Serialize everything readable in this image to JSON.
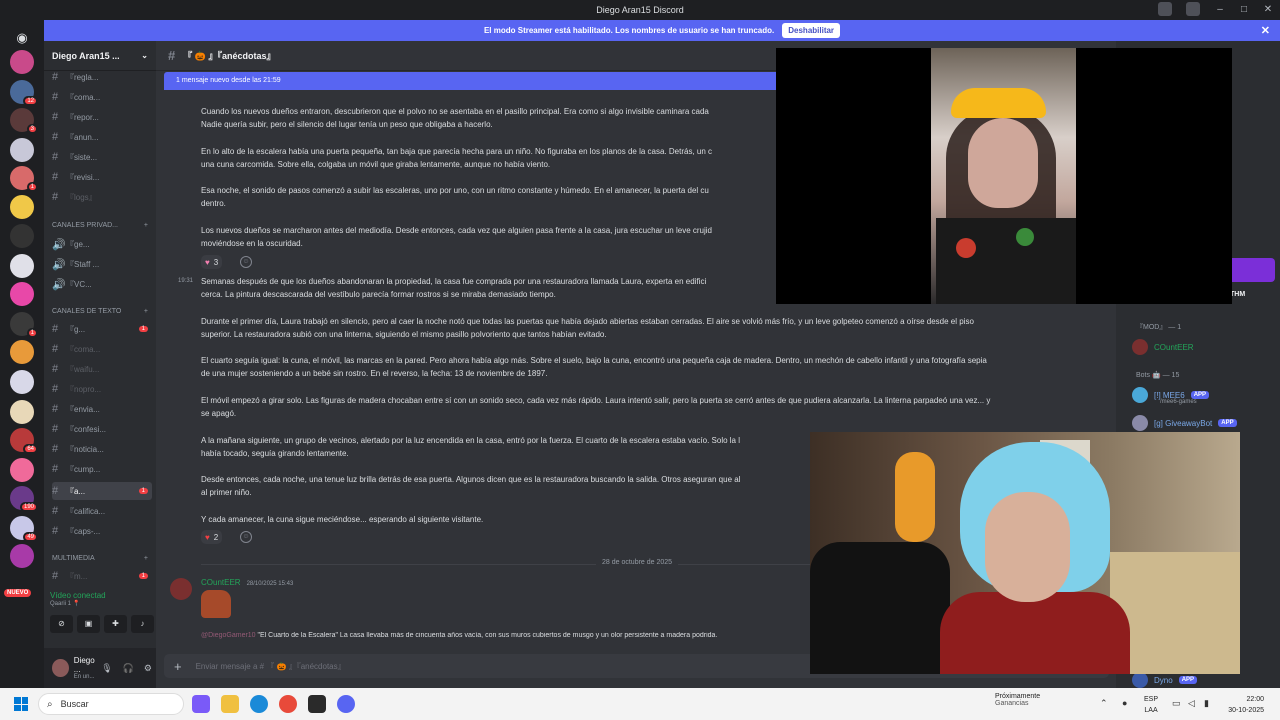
{
  "window": {
    "title": "Diego Aran15 Discord"
  },
  "banner": {
    "text": "El modo Streamer está habilitado. Los nombres de usuario se han truncado.",
    "button": "Deshabilitar"
  },
  "servers": {
    "nuevo": "NUEVO",
    "badges": [
      "12",
      "3",
      "1",
      "1",
      "64",
      "190",
      "49"
    ]
  },
  "guild": {
    "name": "Diego Aran15 ...",
    "channels_top": [
      {
        "label": "『regla..."
      },
      {
        "label": "『coma..."
      },
      {
        "label": "『repor..."
      },
      {
        "label": "『anun..."
      },
      {
        "label": "『siste..."
      },
      {
        "label": "『revisi..."
      },
      {
        "label": "『logs』"
      }
    ],
    "cat_private": "CANALES PRIVAD...",
    "voice_private": [
      {
        "label": "『ge..."
      },
      {
        "label": "『Staff ..."
      },
      {
        "label": "『VC..."
      }
    ],
    "cat_text": "CANALES DE TEXTO",
    "text_channels": [
      {
        "label": "『g...",
        "badge": "1"
      },
      {
        "label": "『coma..."
      },
      {
        "label": "『waifu..."
      },
      {
        "label": "『nopro..."
      },
      {
        "label": "『envia..."
      },
      {
        "label": "『confesi..."
      },
      {
        "label": "『noticia..."
      },
      {
        "label": "『cump..."
      },
      {
        "label": "『a...",
        "badge": "1"
      },
      {
        "label": "『califica..."
      },
      {
        "label": "『caps-..."
      }
    ],
    "cat_media": "MULTIMEDIA",
    "media_channels": [
      {
        "label": "『m...",
        "badge": "1"
      }
    ]
  },
  "voice": {
    "status": "Vídeo conectad",
    "sub": "Qaarii 1 📍"
  },
  "user": {
    "name": "Diego ...",
    "status": "En un..."
  },
  "chat": {
    "channel": "『 🎃 』『anécdotas』",
    "new_messages": "1 mensaje nuevo desde las 21:59",
    "paragraphs": [
      "Cuando los nuevos dueños entraron, descubrieron que el polvo no se asentaba en el pasillo principal. Era como si algo invisible caminara cada",
      "Nadie quería subir, pero el silencio del lugar tenía un peso que obligaba a hacerlo.",
      "En lo alto de la escalera había una puerta pequeña, tan baja que parecía hecha para un niño. No figuraba en los planos de la casa. Detrás, un c",
      "una cuna carcomida. Sobre ella, colgaba un móvil que giraba lentamente, aunque no había viento.",
      "Esa noche, el sonido de pasos comenzó a subir las escaleras, uno por uno, con un ritmo constante y húmedo. En el amanecer, la puerta del cu",
      "dentro.",
      "Los nuevos dueños se marcharon antes del mediodía. Desde entonces, cada vez que alguien pasa frente a la casa, jura escuchar un leve crujid",
      "moviéndose en la oscuridad.",
      "Semanas después de que los dueños abandonaran la propiedad, la casa fue comprada por una restauradora llamada Laura, experta en edifici",
      "cerca. La pintura descascarada del vestíbulo parecía formar rostros si se miraba demasiado tiempo.",
      "Durante el primer día, Laura trabajó en silencio, pero al caer la noche notó que todas las puertas que había dejado abiertas estaban cerradas. El aire se volvió más frío, y un leve golpeteo comenzó a oírse desde el piso",
      "superior. La restauradora subió con una linterna, siguiendo el mismo pasillo polvoriento que tantos habían evitado.",
      "El cuarto seguía igual: la cuna, el móvil, las marcas en la pared. Pero ahora había algo más. Sobre el suelo, bajo la cuna, encontró una pequeña caja de madera. Dentro, un mechón de cabello infantil y una fotografía sepia",
      "de una mujer sosteniendo a un bebé sin rostro. En el reverso, la fecha: 13 de noviembre de 1897.",
      "El móvil empezó a girar solo. Las figuras de madera chocaban entre sí con un sonido seco, cada vez más rápido. Laura intentó salir, pero la puerta se cerró antes de que pudiera alcanzarla. La linterna parpadeó una vez... y",
      "se apagó.",
      "A la mañana siguiente, un grupo de vecinos, alertado por la luz encendida en la casa, entró por la fuerza. El cuarto de la escalera estaba vacío. Solo la l",
      "había tocado, seguía girando lentamente.",
      "Desde entonces, cada noche, una tenue luz brilla detrás de esa puerta. Algunos dicen que es la restauradora buscando la salida. Otros aseguran que al",
      "al primer niño.",
      "Y cada amanecer, la cuna sigue meciéndose... esperando al siguiente visitante."
    ],
    "reaction1": "3",
    "reaction2": "2",
    "timestamp": "19:31",
    "date_divider": "28 de octubre de 2025",
    "author": "COuntEER",
    "author_time": "28/10/2025 15:43",
    "reply_name": "@DiegoGamer10",
    "reply_text": "\"El Cuarto de la Escalera\" La casa llevaba más de cincuenta años vacía, con sus muros cubiertos de musgo y un olor persistente a madera podrida.",
    "composer_placeholder": "Enviar mensaje a # 『 🎃 』『anécdotas』"
  },
  "members": {
    "role_mod": "『MOD』 — 1",
    "mod_user": "COuntEER",
    "role_bots": "Bots 🤖 — 15",
    "bot1": "[!] MEE6",
    "bot1_sub": "/mee6-games",
    "bot2": "[g] GiveawayBot",
    "bot_last": "Dyno",
    "app_tag": "APP",
    "thm": "THM"
  },
  "taskbar": {
    "search": "Buscar",
    "news_title": "Próximamente",
    "news_sub": "Ganancias",
    "lang1": "ESP",
    "lang2": "LAA",
    "time": "22:00",
    "date": "30-10-2025"
  }
}
